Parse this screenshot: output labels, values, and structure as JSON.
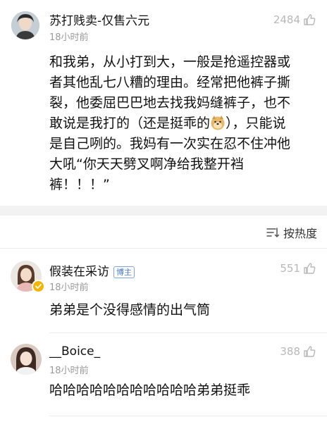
{
  "main_post": {
    "username": "苏打贱卖-仅售六元",
    "time": "18小时前",
    "likes": "2484",
    "text_lines": [
      "和我弟，从小打到大，一般是抢遥控器或",
      "者其他乱七八糟的理由。经常把他裤子撕",
      "裂，他委屈巴巴地去找我妈缝裤子，也不",
      "敢说是我打的（还是挺乖的",
      "），只能说",
      "是自己咧的。我妈有一次实在忍不住冲他",
      "大吼“你天天劈叉啊净给我整开裆",
      "裤！！！”"
    ]
  },
  "sort": {
    "label": "按热度"
  },
  "comments": [
    {
      "username": "假装在采访",
      "badge": "博主",
      "time": "18小时前",
      "likes": "551",
      "text": "弟弟是个没得感情的出气筒"
    },
    {
      "username": "__Boice_",
      "time": "18小时前",
      "likes": "388",
      "text": "哈哈哈哈哈哈哈哈哈哈哈弟弟挺乖"
    }
  ],
  "colors": {
    "band": "#f2f2f2",
    "muted": "#9a9a9a",
    "badge_blue": "#4a78c2",
    "verified_yellow": "#f5b400"
  }
}
